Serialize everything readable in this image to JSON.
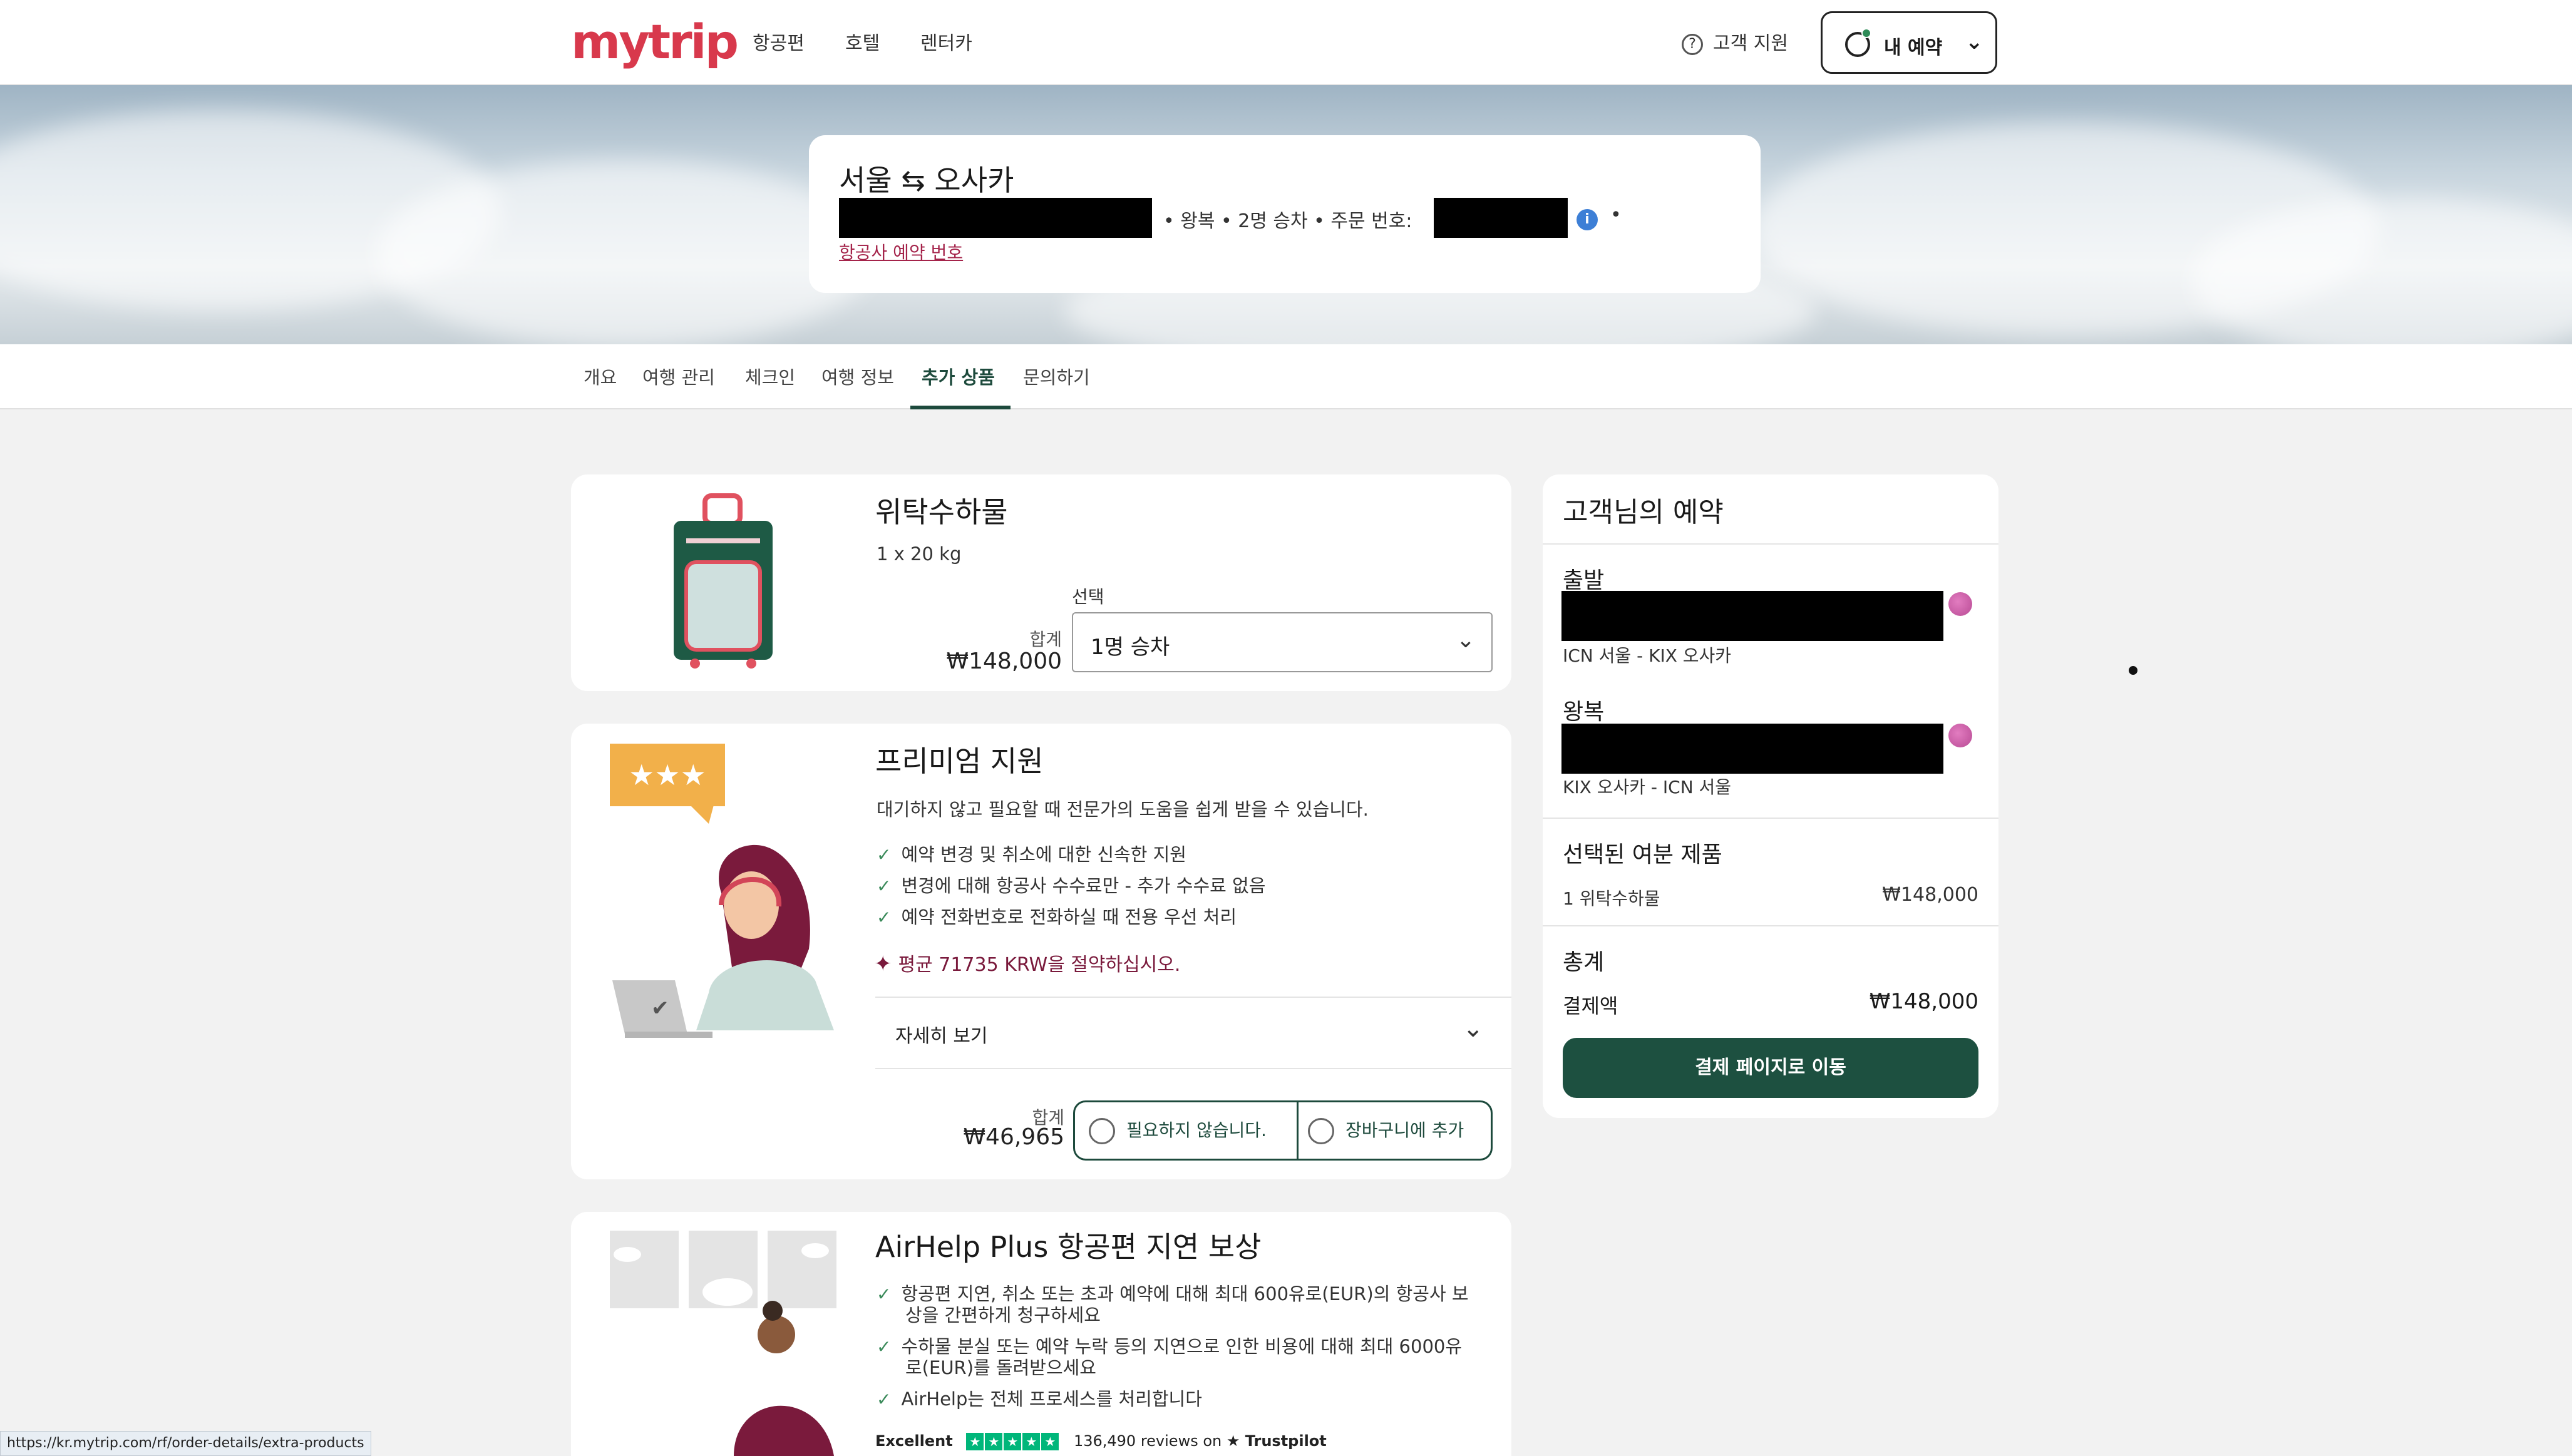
{
  "brand": {
    "logo": "mytrip",
    "accent": "#d8394c",
    "primary": "#1d5040"
  },
  "header": {
    "nav": [
      "항공편",
      "호텔",
      "렌터카"
    ],
    "support_label": "고객 지원",
    "my_booking_label": "내 예약"
  },
  "trip": {
    "route": "서울 ⇆ 오사카",
    "meta": "• 왕복  • 2명 승차  • 주문 번호:",
    "airline_ref_label": "항공사 예약 번호"
  },
  "tabs": [
    "개요",
    "여행 관리",
    "체크인",
    "여행 정보",
    "추가 상품",
    "문의하기"
  ],
  "baggage": {
    "title": "위탁수하물",
    "weight": "1 x 20 kg",
    "select_label": "선택",
    "total_label": "합계",
    "price": "₩148,000",
    "selected_option": "1명 승차"
  },
  "premium": {
    "title": "프리미엄 지원",
    "subtitle": "대기하지 않고 필요할 때 전문가의 도움을 쉽게 받을 수 있습니다.",
    "features": [
      "예약 변경 및 취소에 대한 신속한 지원",
      "변경에 대해 항공사 수수료만 - 추가 수수료 없음",
      "예약 전화번호로 전화하실 때 전용 우선 처리"
    ],
    "savings": "평균 71735 KRW을 절약하십시오.",
    "details_label": "자세히 보기",
    "total_label": "합계",
    "price": "₩46,965",
    "option_no": "필요하지 않습니다.",
    "option_add": "장바구니에 추가"
  },
  "airhelp": {
    "title": "AirHelp Plus 항공편 지연 보상",
    "features": [
      [
        "항공편 지연, 취소 또는 초과 예약에 대해 최대 600유로(EUR)의 항공사 보",
        "상을 간편하게 청구하세요"
      ],
      [
        "수하물 분실 또는 예약 누락 등의 지연으로 인한 비용에 대해 최대 6000유",
        "로(EUR)를 돌려받으세요"
      ],
      [
        "AirHelp는 전체 프로세스를 처리합니다"
      ]
    ],
    "trust_rating": "Excellent",
    "trust_reviews": "136,490 reviews on",
    "trust_brand": "★ Trustpilot"
  },
  "summary": {
    "title": "고객님의 예약",
    "outbound_label": "출발",
    "outbound_route": "ICN 서울 - KIX 오사카",
    "return_label": "왕복",
    "return_route": "KIX 오사카 - ICN 서울",
    "extras_title": "선택된 여분 제품",
    "extra_item": "1 위탁수하물",
    "extra_price": "₩148,000",
    "total_title": "총계",
    "payment_label": "결제액",
    "payment_value": "₩148,000",
    "pay_button": "결제 페이지로 이동"
  },
  "status_url": "https://kr.mytrip.com/rf/order-details/extra-products"
}
